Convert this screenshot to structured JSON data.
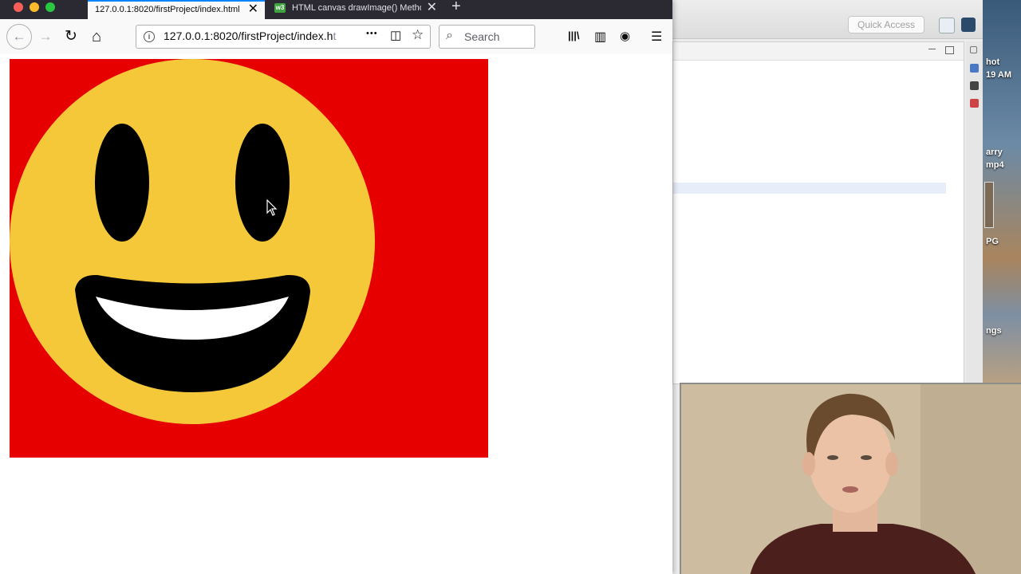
{
  "browser": {
    "tabs": [
      {
        "title": "127.0.0.1:8020/firstProject/index.html",
        "active": true
      },
      {
        "title": "HTML canvas drawImage() Method",
        "active": false,
        "favicon_text": "w3"
      }
    ],
    "url": {
      "main": "127.0.0.1:8020/firstProject/index.h",
      "faded": "t"
    },
    "search_placeholder": "Search",
    "icons": {
      "back": "arrow-left-icon",
      "forward": "arrow-right-icon",
      "reload": "reload-icon",
      "home": "home-icon",
      "page_actions": "more-icon",
      "pocket": "pocket-icon",
      "bookmark": "star-icon",
      "library": "library-icon",
      "sidebar": "sidebar-icon",
      "account": "account-icon",
      "menu": "hamburger-icon"
    },
    "glyphs": {
      "close": "✕",
      "new_tab": "+",
      "back": "←",
      "forward": "→",
      "reload": "↻",
      "home": "⌂",
      "info": "i",
      "more": "•••",
      "pocket": "◫",
      "star": "☆",
      "search": "⌕",
      "library": "|||\\",
      "sidebar": "▥",
      "account": "◉",
      "menu": "☰"
    }
  },
  "canvas": {
    "background_color": "#e60000",
    "face_color": "#f5c83a",
    "feature_color": "#000000",
    "teeth_color": "#ffffff"
  },
  "ide": {
    "quick_access": "Quick Access"
  },
  "desktop": {
    "labels": [
      "hot",
      "19 AM",
      "arry",
      "mp4",
      "PG",
      "ngs"
    ]
  }
}
